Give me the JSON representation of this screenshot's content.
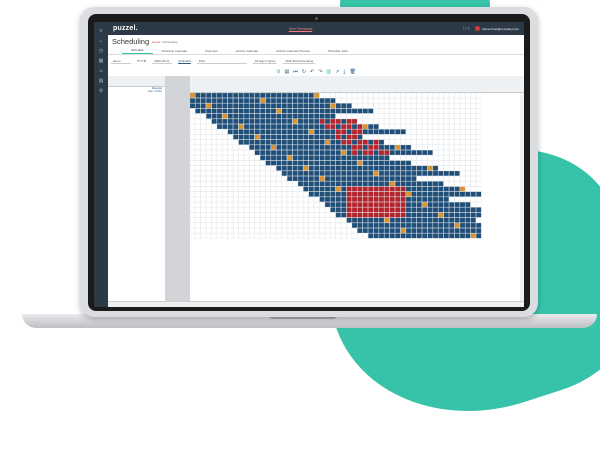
{
  "app": {
    "logo": "puzzel.",
    "feedback": "Give Feedback",
    "user": "Demo.User@company.com"
  },
  "page": {
    "title": "Scheduling",
    "crumb_home": "Home",
    "crumb_current": "Scheduling"
  },
  "tabs": [
    {
      "label": "Schedule"
    },
    {
      "label": "Schedule Calendar"
    },
    {
      "label": "Overview"
    },
    {
      "label": "Activity Calendar"
    },
    {
      "label": "Activity Calendar Preview"
    },
    {
      "label": "Schedule Jobs"
    }
  ],
  "filters": {
    "date": "2020-03-21",
    "queues": "QUEUES",
    "filter_placeholder": "Filter",
    "agent_type": "All Agent Types",
    "sort": "Shift Start Ascending",
    "units": "demo"
  },
  "colors": {
    "teal": "#37c3a9",
    "navy": "#1f4e79",
    "orange": "#d89433",
    "red": "#b5232d",
    "white": "#ffffff"
  },
  "grid": {
    "header_labels": [
      "Required",
      "Over / Under"
    ],
    "sidebar_icons": [
      "menu-icon",
      "home-icon",
      "clock-icon",
      "calendar-icon",
      "people-icon",
      "settings-icon",
      "chart-icon"
    ]
  }
}
